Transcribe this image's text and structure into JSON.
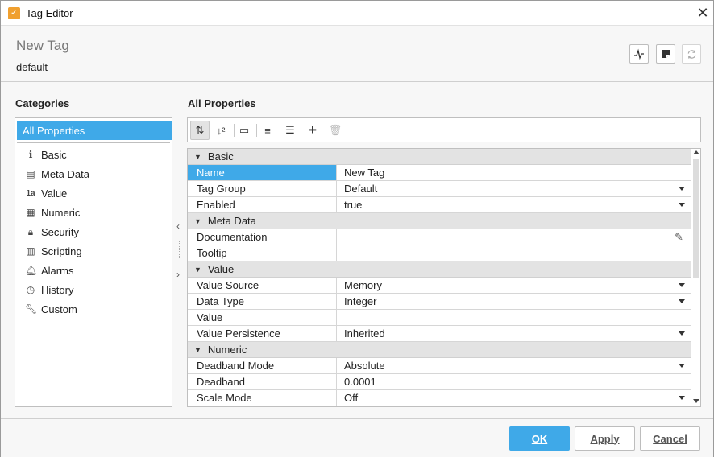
{
  "window": {
    "title": "Tag Editor"
  },
  "header": {
    "tag_name": "New Tag",
    "provider": "default"
  },
  "categories": {
    "title": "Categories",
    "items": [
      {
        "label": "All Properties",
        "icon": "none",
        "selected": true
      },
      {
        "label": "Basic",
        "icon": "info-icon"
      },
      {
        "label": "Meta Data",
        "icon": "metadata-icon"
      },
      {
        "label": "Value",
        "icon": "value-icon"
      },
      {
        "label": "Numeric",
        "icon": "calculator-icon"
      },
      {
        "label": "Security",
        "icon": "lock-icon"
      },
      {
        "label": "Scripting",
        "icon": "script-icon"
      },
      {
        "label": "Alarms",
        "icon": "bell-icon"
      },
      {
        "label": "History",
        "icon": "clock-icon"
      },
      {
        "label": "Custom",
        "icon": "wrench-icon"
      }
    ]
  },
  "properties": {
    "title": "All Properties",
    "groups": [
      {
        "name": "Basic",
        "rows": [
          {
            "name": "Name",
            "value": "New Tag",
            "selected": true
          },
          {
            "name": "Tag Group",
            "value": "Default",
            "dropdown": true
          },
          {
            "name": "Enabled",
            "value": "true",
            "dropdown": true
          }
        ]
      },
      {
        "name": "Meta Data",
        "rows": [
          {
            "name": "Documentation",
            "value": "",
            "editor": true
          },
          {
            "name": "Tooltip",
            "value": ""
          }
        ]
      },
      {
        "name": "Value",
        "rows": [
          {
            "name": "Value Source",
            "value": "Memory",
            "dropdown": true
          },
          {
            "name": "Data Type",
            "value": "Integer",
            "dropdown": true
          },
          {
            "name": "Value",
            "value": ""
          },
          {
            "name": "Value Persistence",
            "value": "Inherited",
            "dropdown": true
          }
        ]
      },
      {
        "name": "Numeric",
        "rows": [
          {
            "name": "Deadband Mode",
            "value": "Absolute",
            "dropdown": true
          },
          {
            "name": "Deadband",
            "value": "0.0001"
          },
          {
            "name": "Scale Mode",
            "value": "Off",
            "dropdown": true
          }
        ]
      }
    ]
  },
  "footer": {
    "ok": "OK",
    "apply": "Apply",
    "cancel": "Cancel"
  },
  "colors": {
    "accent": "#3fa9e8",
    "group_bg": "#e3e3e3",
    "app_icon": "#f0a030"
  }
}
